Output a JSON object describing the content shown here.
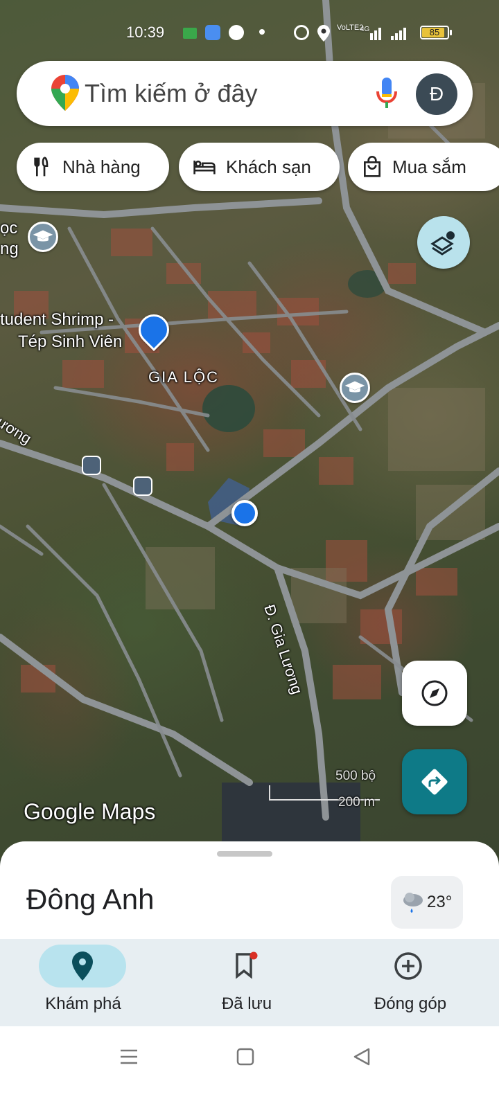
{
  "status_bar": {
    "time": "10:39",
    "battery": "85",
    "network": "4G",
    "volte": "VoLTE2"
  },
  "search": {
    "placeholder": "Tìm kiếm ở đây",
    "avatar_letter": "Đ"
  },
  "chips": [
    {
      "label": "Nhà hàng",
      "icon": "restaurant-icon"
    },
    {
      "label": "Khách sạn",
      "icon": "hotel-icon"
    },
    {
      "label": "Mua sắm",
      "icon": "shopping-bag-icon"
    }
  ],
  "map": {
    "labels": {
      "school_partial_1": "ọc",
      "school_partial_2": "ng",
      "poi_shop_line1": "tudent Shrimp -",
      "poi_shop_line2": "Tép Sinh Viên",
      "area_name": "GIA LỘC",
      "road_left": "Lương",
      "road_main": "Đ. Gia Lương",
      "brand": "Google Maps",
      "scale_imperial": "500 bộ",
      "scale_metric": "200 m"
    },
    "colors": {
      "location_dot": "#1a73e8",
      "road": "#8a8f93",
      "directions_button": "#0e7a87",
      "layers_button": "#b9e2ec"
    }
  },
  "bottom_sheet": {
    "title": "Đông Anh",
    "weather_temp": "23°",
    "weather_icon": "rain-cloud-icon"
  },
  "bottom_nav": [
    {
      "label": "Khám phá",
      "icon": "explore-pin-icon",
      "active": true
    },
    {
      "label": "Đã lưu",
      "icon": "bookmark-icon",
      "active": false
    },
    {
      "label": "Đóng góp",
      "icon": "add-circle-icon",
      "active": false
    }
  ],
  "system_nav": [
    "menu-icon",
    "home-square-icon",
    "back-triangle-icon"
  ]
}
